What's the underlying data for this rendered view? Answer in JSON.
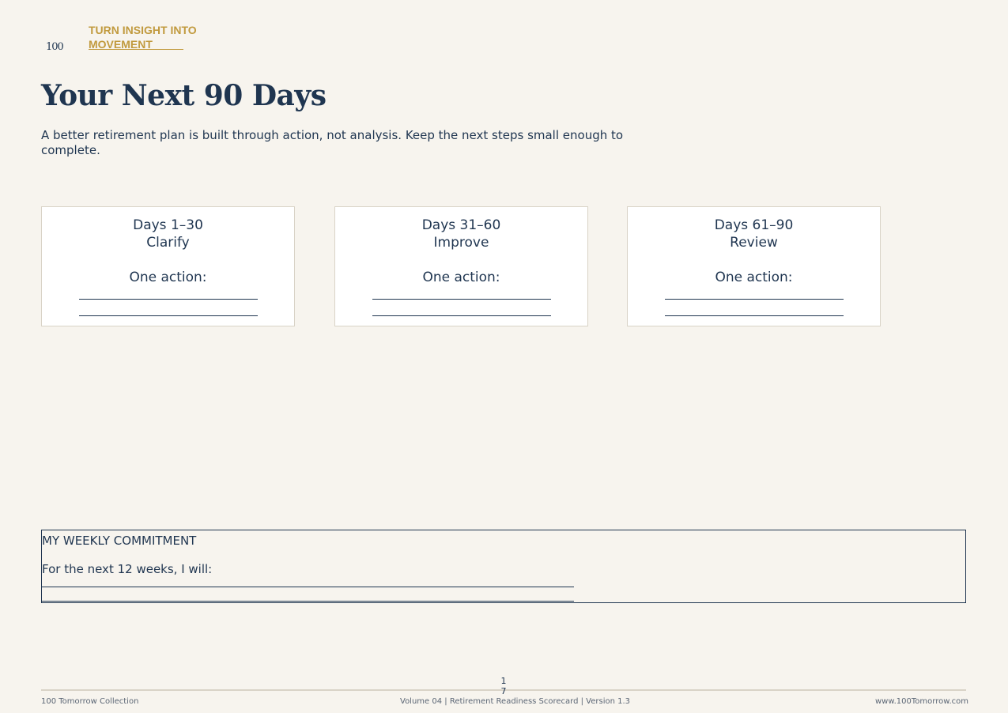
{
  "brand": {
    "logo": "100"
  },
  "header": {
    "kicker": "TURN INSIGHT INTO MOVEMENT"
  },
  "page": {
    "title": "Your Next 90 Days",
    "subtitle": "A better retirement plan is built through action, not analysis. Keep the next steps small enough to complete."
  },
  "cards": [
    {
      "range": "Days 1–30",
      "theme": "Clarify",
      "action_label": "One action:"
    },
    {
      "range": "Days 31–60",
      "theme": "Improve",
      "action_label": "One action:"
    },
    {
      "range": "Days 61–90",
      "theme": "Review",
      "action_label": "One action:"
    }
  ],
  "commitment": {
    "heading": "MY WEEKLY COMMITMENT",
    "lead": "For the next 12 weeks, I will:"
  },
  "footer": {
    "left": "100 Tomorrow Collection",
    "center": "Volume 04 | Retirement Readiness Scorecard | Version 1.3",
    "right": "www.100Tomorrow.com",
    "page_number": "17"
  },
  "colors": {
    "navy": "#1f3550",
    "gold": "#c19a3e",
    "background": "#f7f4ee"
  }
}
